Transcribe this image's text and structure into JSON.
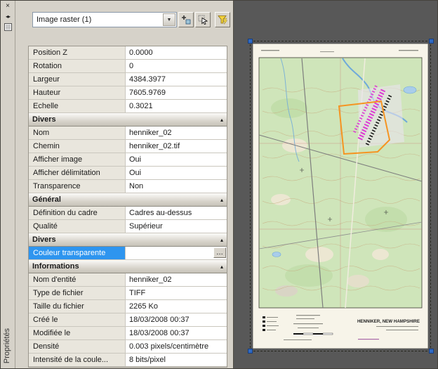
{
  "palette": {
    "title": "Propriétés",
    "selector_value": "Image raster (1)",
    "icons": {
      "close": "×",
      "auto_hide": "◂▸",
      "dropdown": "▼",
      "collapse": "▴",
      "ellipsis": "…"
    },
    "toolbar": [
      {
        "name": "toggle-pickadd-button"
      },
      {
        "name": "select-objects-button"
      },
      {
        "name": "quick-select-button"
      }
    ],
    "sections": [
      {
        "header": null,
        "rows": [
          {
            "label": "Position Z",
            "value": "0.0000"
          },
          {
            "label": "Rotation",
            "value": "0"
          },
          {
            "label": "Largeur",
            "value": "4384.3977"
          },
          {
            "label": "Hauteur",
            "value": "7605.9769"
          },
          {
            "label": "Echelle",
            "value": "0.3021"
          }
        ]
      },
      {
        "header": "Divers",
        "rows": [
          {
            "label": "Nom",
            "value": "henniker_02"
          },
          {
            "label": "Chemin",
            "value": "henniker_02.tif"
          },
          {
            "label": "Afficher image",
            "value": "Oui"
          },
          {
            "label": "Afficher délimitation",
            "value": "Oui"
          },
          {
            "label": "Transparence",
            "value": "Non"
          }
        ]
      },
      {
        "header": "Général",
        "rows": [
          {
            "label": "Définition du cadre",
            "value": "Cadres au-dessus"
          },
          {
            "label": "Qualité",
            "value": "Supérieur"
          }
        ]
      },
      {
        "header": "Divers",
        "rows": [
          {
            "label": "Couleur transparente",
            "value": "",
            "selected": true,
            "ellipsis": true
          }
        ]
      },
      {
        "header": "Informations",
        "rows": [
          {
            "label": "Nom d'entité",
            "value": "henniker_02"
          },
          {
            "label": "Type de fichier",
            "value": "TIFF"
          },
          {
            "label": "Taille du fichier",
            "value": "2265 Ko"
          },
          {
            "label": "Créé le",
            "value": "18/03/2008 00:37"
          },
          {
            "label": "Modifiée le",
            "value": "18/03/2008 00:37"
          },
          {
            "label": "Densité",
            "value": "0.003 pixels/centimètre"
          },
          {
            "label": "Intensité de la coule...",
            "value": "8 bits/pixel"
          }
        ]
      }
    ]
  },
  "canvas": {
    "map_caption": "HENNIKER, NEW HAMPSHIRE"
  },
  "colors": {
    "selection_highlight": "#2e95ef",
    "grip_blue": "#2f6ac4",
    "canvas_background": "#585858",
    "map_green": "#cfe5ba",
    "parcel_orange": "#f59422",
    "urban_magenta": "#dd3ad4"
  }
}
